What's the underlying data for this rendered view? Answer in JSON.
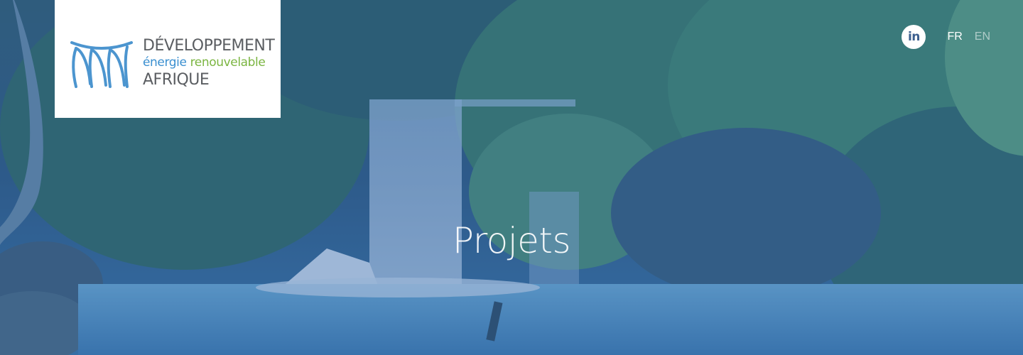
{
  "logo": {
    "line1": "DÉVELOPPEMENT",
    "line2_part1": "énergie",
    "line2_part2": "renouvelable",
    "line3": "AFRIQUE",
    "colors": {
      "blue": "#3a8fd0",
      "green": "#7bb541",
      "grey": "#5b5e62"
    }
  },
  "header": {
    "social_icon": "linkedin-icon",
    "social_label": "in",
    "languages": [
      {
        "code": "FR",
        "active": true
      },
      {
        "code": "EN",
        "active": false
      }
    ]
  },
  "hero": {
    "title": "Projets",
    "overlay_color": "#3d6aa0"
  }
}
